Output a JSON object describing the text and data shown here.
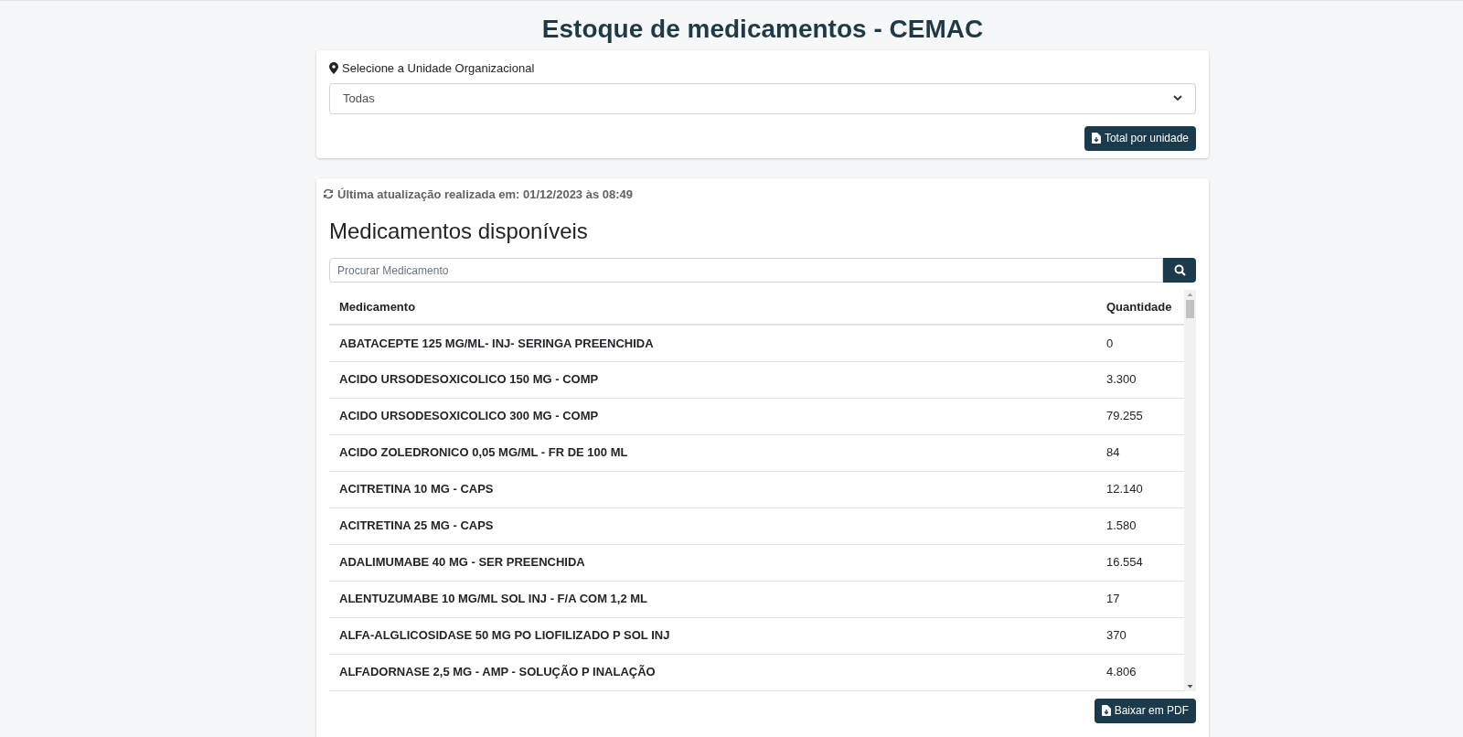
{
  "page_title": "Estoque de medicamentos - CEMAC",
  "unit_filter": {
    "label": "Selecione a Unidade Organizacional",
    "value": "Todas",
    "button": "Total por unidade"
  },
  "stock": {
    "last_update": "Última atualização realizada em: 01/12/2023 às 08:49",
    "heading": "Medicamentos disponíveis",
    "search": {
      "placeholder": "Procurar Medicamento"
    },
    "columns": [
      "Medicamento",
      "Quantidade"
    ],
    "rows": [
      {
        "name": "ABATACEPTE 125 MG/ML- INJ- SERINGA PREENCHIDA",
        "quantity": "0"
      },
      {
        "name": "ACIDO URSODESOXICOLICO 150 MG - COMP",
        "quantity": "3.300"
      },
      {
        "name": "ACIDO URSODESOXICOLICO 300 MG - COMP",
        "quantity": "79.255"
      },
      {
        "name": "ACIDO ZOLEDRONICO 0,05 MG/ML - FR DE 100 ML",
        "quantity": "84"
      },
      {
        "name": "ACITRETINA 10 MG - CAPS",
        "quantity": "12.140"
      },
      {
        "name": "ACITRETINA 25 MG - CAPS",
        "quantity": "1.580"
      },
      {
        "name": "ADALIMUMABE 40 MG - SER PREENCHIDA",
        "quantity": "16.554"
      },
      {
        "name": "ALENTUZUMABE 10 MG/ML SOL INJ - F/A COM 1,2 ML",
        "quantity": "17"
      },
      {
        "name": "ALFA-ALGLICOSIDASE 50 MG PO LIOFILIZADO P SOL INJ",
        "quantity": "370"
      },
      {
        "name": "ALFADORNASE 2,5 MG - AMP - SOLUÇÃO P INALAÇÃO",
        "quantity": "4.806"
      }
    ],
    "pdf_button": "Baixar em PDF"
  }
}
